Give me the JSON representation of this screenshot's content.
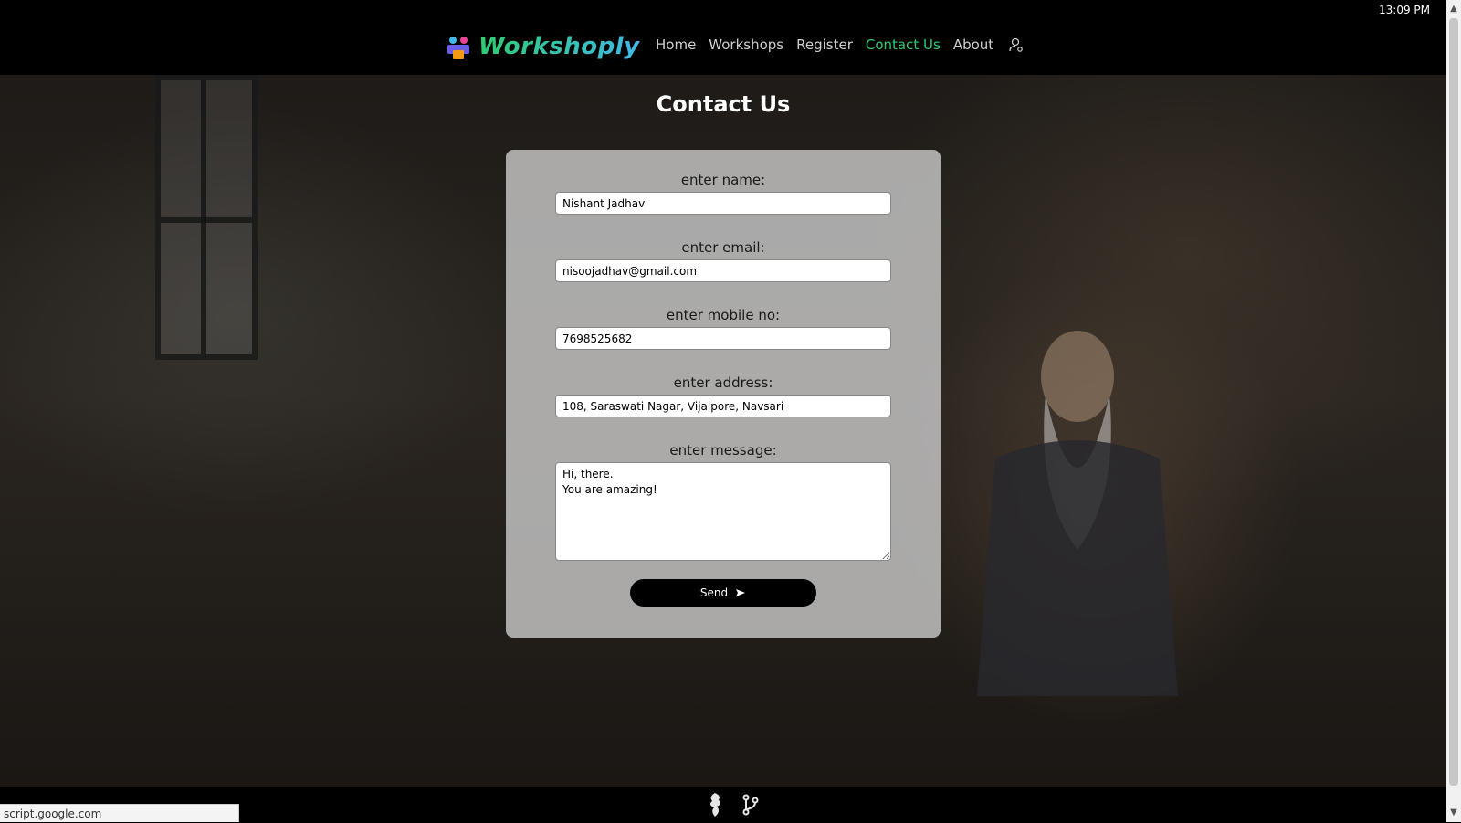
{
  "system": {
    "clock": "13:09 PM"
  },
  "brand": {
    "name": "Workshoply"
  },
  "nav": {
    "items": [
      "Home",
      "Workshops",
      "Register",
      "Contact Us",
      "About"
    ],
    "active": "Contact Us"
  },
  "page": {
    "title": "Contact Us"
  },
  "form": {
    "name": {
      "label": "enter name:",
      "value": "Nishant Jadhav"
    },
    "email": {
      "label": "enter email:",
      "value": "nisoojadhav@gmail.com"
    },
    "mobile": {
      "label": "enter mobile no:",
      "value": "7698525682"
    },
    "address": {
      "label": "enter address:",
      "value": "108, Saraswati Nagar, Vijalpore, Navsari"
    },
    "message": {
      "label": "enter message:",
      "value": "Hi, there.\nYou are amazing!"
    },
    "send_label": "Send"
  },
  "status_bar": {
    "url": "script.google.com"
  },
  "colors": {
    "accent": "#2ecc71",
    "card": "#c8c8c8"
  },
  "icons": [
    "workshop-logo-icon",
    "user-icon",
    "send-arrow-icon",
    "dragon-logo-icon",
    "git-branch-icon"
  ]
}
